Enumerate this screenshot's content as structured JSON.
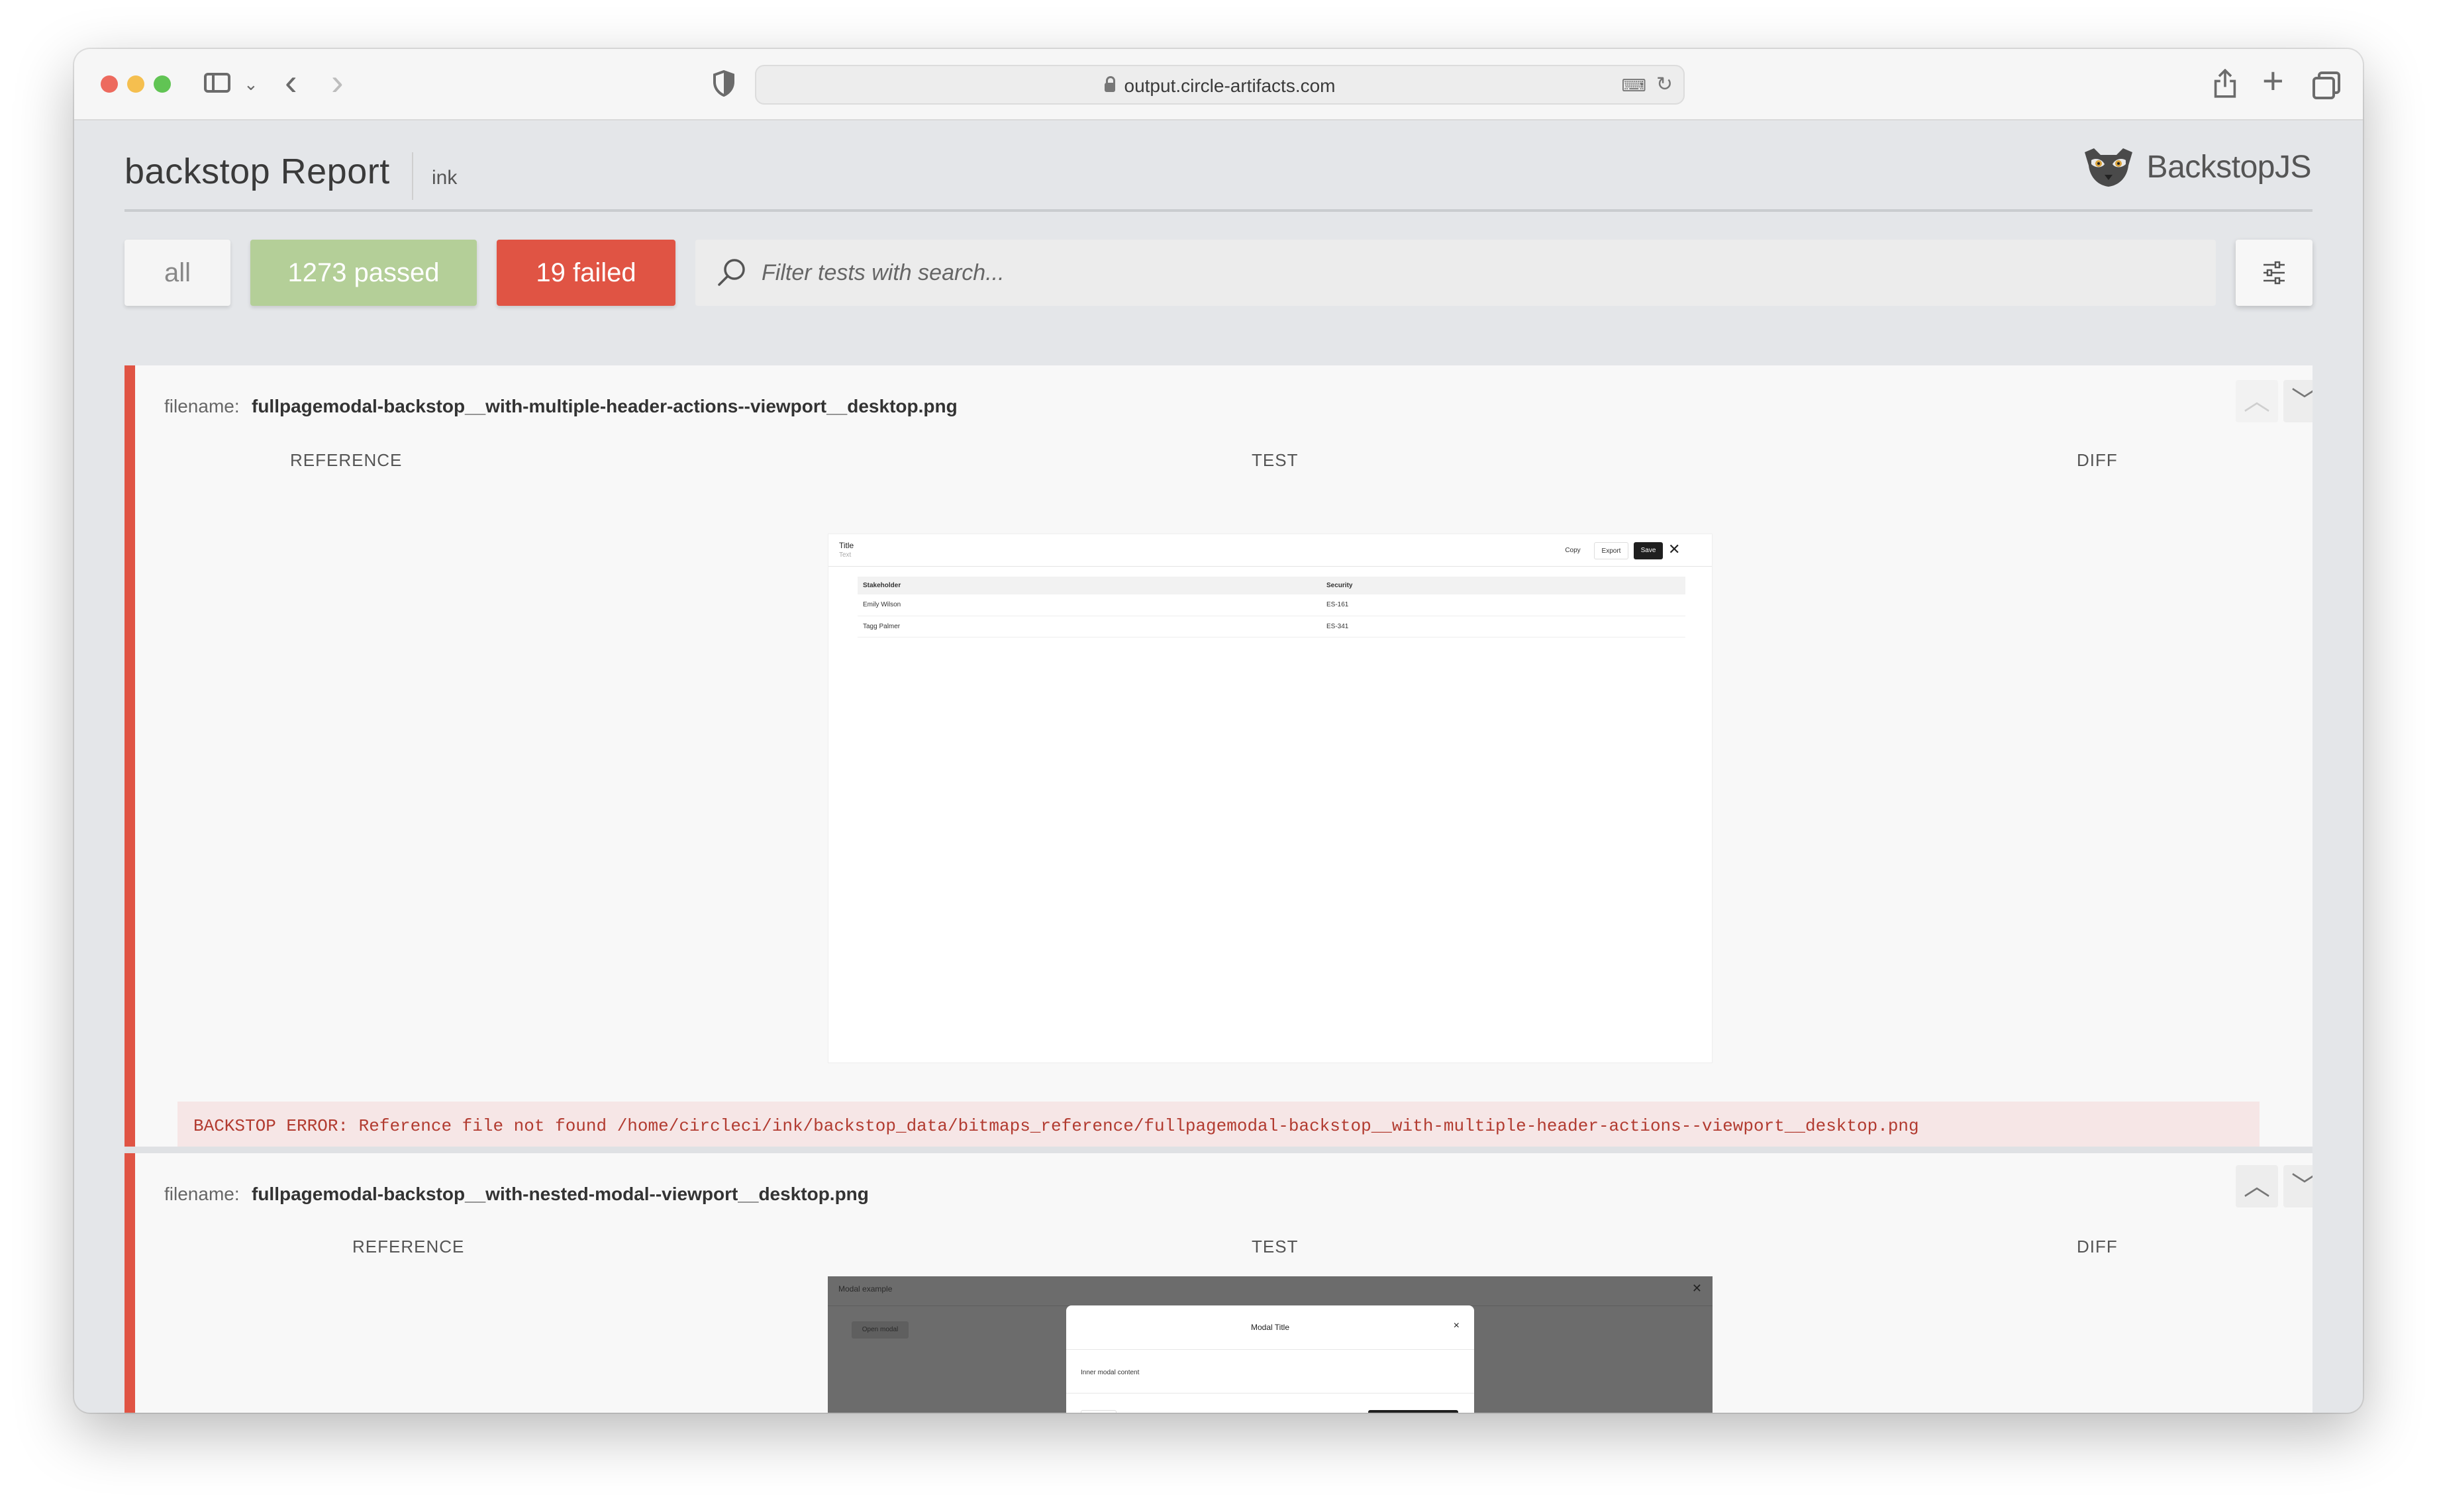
{
  "browser": {
    "url": "output.circle-artifacts.com"
  },
  "report": {
    "title": "backstop Report",
    "project": "ink",
    "logo_text": "BackstopJS"
  },
  "filters": {
    "all_label": "all",
    "passed_label": "1273 passed",
    "failed_label": "19 failed",
    "search_placeholder": "Filter tests with search...",
    "colors": {
      "passed": "#b4cf98",
      "failed": "#e05444"
    }
  },
  "tests": [
    {
      "filename_label": "filename:",
      "filename": "fullpagemodal-backstop__with-multiple-header-actions--viewport__desktop.png",
      "columns": [
        "REFERENCE",
        "TEST",
        "DIFF"
      ],
      "test_image": {
        "title": "Title",
        "subtitle": "Text",
        "actions": [
          "Copy",
          "Export",
          "Save"
        ],
        "close": "✕",
        "table_headers": [
          "Stakeholder",
          "Security"
        ],
        "table_rows": [
          [
            "Emily Wilson",
            "ES-161"
          ],
          [
            "Tagg Palmer",
            "ES-341"
          ]
        ]
      },
      "error": "BACKSTOP ERROR: Reference file not found /home/circleci/ink/backstop_data/bitmaps_reference/fullpagemodal-backstop__with-multiple-header-actions--viewport__desktop.png"
    },
    {
      "filename_label": "filename:",
      "filename": "fullpagemodal-backstop__with-nested-modal--viewport__desktop.png",
      "columns": [
        "REFERENCE",
        "TEST",
        "DIFF"
      ],
      "test_image": {
        "title": "Modal example",
        "close": "✕",
        "open_button": "Open modal",
        "modal_title": "Modal Title",
        "modal_close": "×",
        "modal_content": "Inner modal content"
      }
    }
  ]
}
